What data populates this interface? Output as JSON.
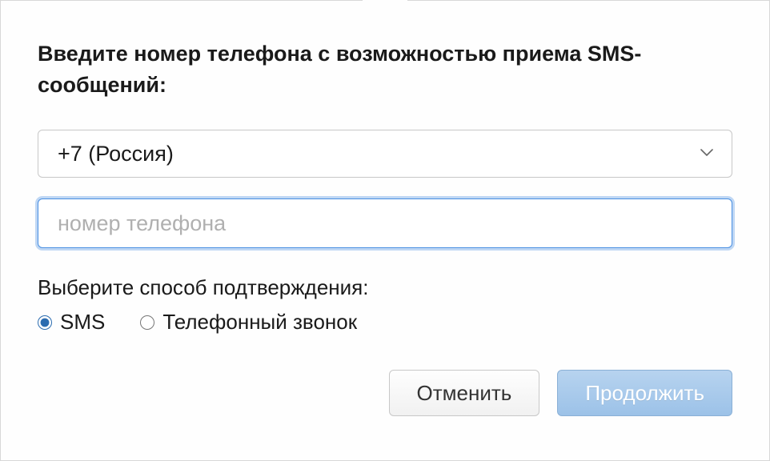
{
  "instruction": "Введите номер телефона с возможностью приема SMS-сообщений:",
  "country": {
    "selected": "+7 (Россия)"
  },
  "phone": {
    "value": "",
    "placeholder": "номер телефона"
  },
  "verification": {
    "label": "Выберите способ подтверждения:",
    "options": {
      "sms": "SMS",
      "call": "Телефонный звонок"
    },
    "selected": "sms"
  },
  "buttons": {
    "cancel": "Отменить",
    "continue": "Продолжить"
  }
}
